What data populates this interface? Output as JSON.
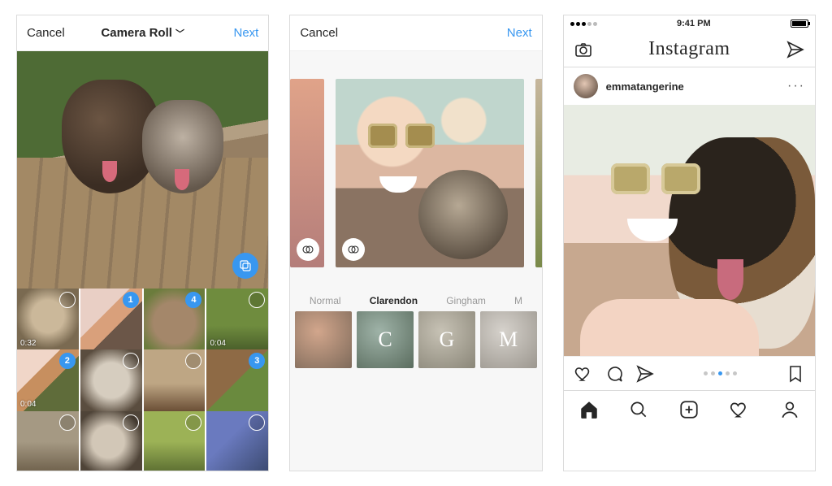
{
  "screen1": {
    "cancel": "Cancel",
    "title": "Camera Roll",
    "next": "Next",
    "multi_select_icon": "multi-select-icon",
    "thumbs": [
      {
        "selected": null,
        "duration": "0:32"
      },
      {
        "selected": 1,
        "duration": null
      },
      {
        "selected": 4,
        "duration": null
      },
      {
        "selected": null,
        "duration": "0:04"
      },
      {
        "selected": 2,
        "duration": "0:04"
      },
      {
        "selected": null,
        "duration": null
      },
      {
        "selected": null,
        "duration": null
      },
      {
        "selected": 3,
        "duration": null
      },
      {
        "selected": null,
        "duration": null
      },
      {
        "selected": null,
        "duration": null
      },
      {
        "selected": null,
        "duration": null
      },
      {
        "selected": null,
        "duration": null
      }
    ]
  },
  "screen2": {
    "cancel": "Cancel",
    "next": "Next",
    "effects_icon": "venn-effects-icon",
    "filters": [
      {
        "name": "Normal",
        "glyph": "",
        "selected": false
      },
      {
        "name": "Clarendon",
        "glyph": "C",
        "selected": true
      },
      {
        "name": "Gingham",
        "glyph": "G",
        "selected": false
      },
      {
        "name": "M",
        "glyph": "M",
        "selected": false
      }
    ]
  },
  "screen3": {
    "status": {
      "time": "9:41 PM"
    },
    "header": {
      "camera_icon": "camera-icon",
      "logo": "Instagram",
      "send_icon": "paper-plane-icon"
    },
    "post": {
      "username": "emmatangerine",
      "more": "···",
      "carousel": {
        "count": 5,
        "index": 2
      }
    },
    "actions": {
      "like": "heart-icon",
      "comment": "comment-icon",
      "share": "paper-plane-icon",
      "save": "bookmark-icon"
    },
    "tabs": {
      "home": "home-icon",
      "search": "search-icon",
      "add": "plus-box-icon",
      "activity": "heart-icon",
      "profile": "person-icon"
    }
  }
}
